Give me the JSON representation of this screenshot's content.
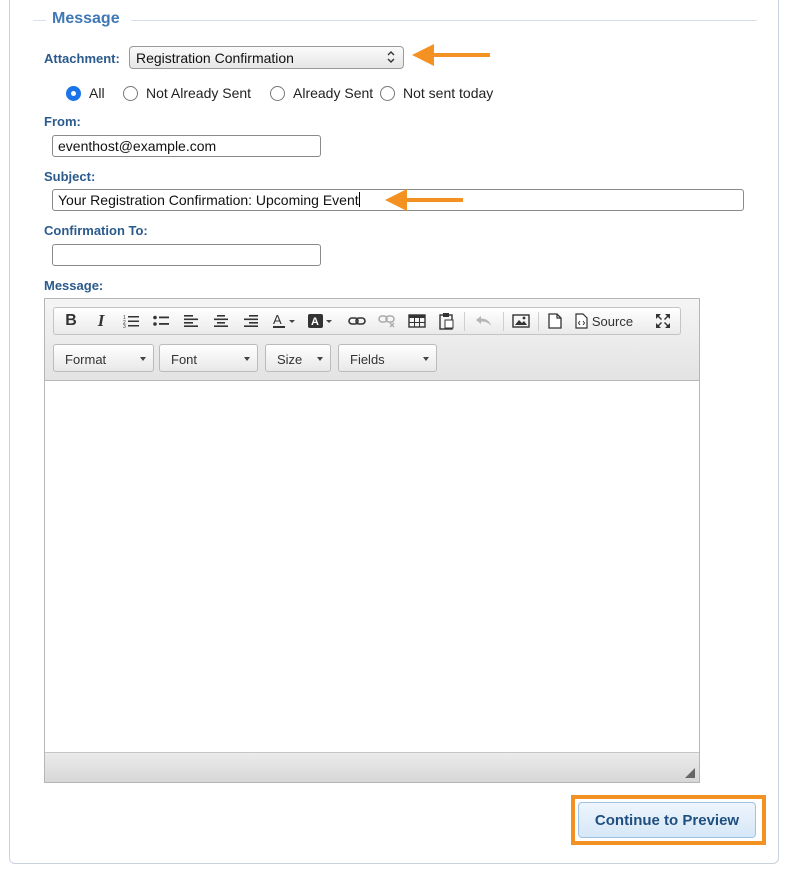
{
  "section": {
    "legend": "Message"
  },
  "attachment": {
    "label": "Attachment:",
    "selected": "Registration Confirmation"
  },
  "filter": {
    "options": [
      "All",
      "Not Already Sent",
      "Already Sent",
      "Not sent today"
    ],
    "selected": "All"
  },
  "from": {
    "label": "From:",
    "value": "eventhost@example.com"
  },
  "subject": {
    "label": "Subject:",
    "value": "Your Registration Confirmation: Upcoming Event"
  },
  "confirmation_to": {
    "label": "Confirmation To:",
    "value": ""
  },
  "message": {
    "label": "Message:",
    "toolbar": {
      "buttons": [
        "bold-icon",
        "italic-icon",
        "numbered-list-icon",
        "bulleted-list-icon",
        "align-left-icon",
        "align-center-icon",
        "align-right-icon",
        "text-color-icon",
        "background-color-icon",
        "link-icon",
        "unlink-icon",
        "table-icon",
        "paste-icon",
        "undo-icon",
        "image-icon",
        "new-page-icon",
        "source-icon",
        "maximize-icon"
      ],
      "source_label": "Source",
      "combos": [
        "Format",
        "Font",
        "Size",
        "Fields"
      ]
    },
    "body": ""
  },
  "actions": {
    "continue_label": "Continue to Preview"
  },
  "colors": {
    "accent": "#3f78b5",
    "label": "#2b5a8c",
    "highlight": "#f39222"
  }
}
